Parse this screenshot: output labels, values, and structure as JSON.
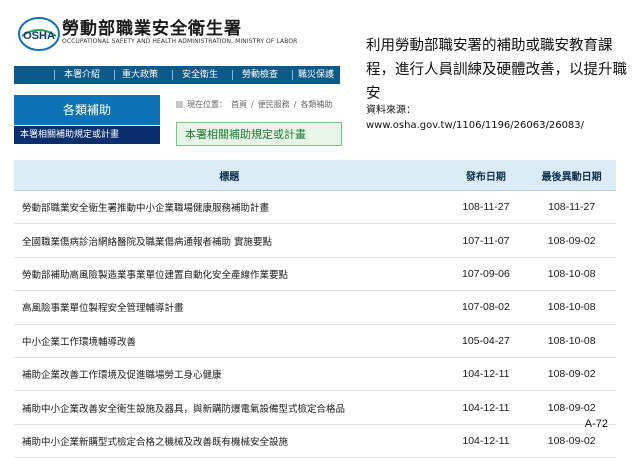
{
  "header": {
    "logo_text": "OSHA",
    "title": "勞動部職業安全衛生署",
    "subtitle": "OCCUPATIONAL SAFETY AND HEALTH ADMINISTRATION, MINISTRY OF LABOR"
  },
  "nav": {
    "items": [
      "本署介紹",
      "重大政策",
      "安全衛生",
      "勞動檢查",
      "職災保護"
    ]
  },
  "sidebar": {
    "heading": "各類補助",
    "items": [
      "本署相關補助規定或計畫"
    ]
  },
  "breadcrumb": {
    "label": "現在位置：",
    "items": [
      "首頁",
      "便民服務",
      "各類補助"
    ]
  },
  "page_title": "本署相關補助規定或計畫",
  "caption": {
    "text": "利用勞動部職安署的補助或職安教育課程，進行人員訓練及硬體改善，以提升職安",
    "source": "資料來源： www.osha.gov.tw/1106/1196/26063/26083/"
  },
  "table": {
    "headers": [
      "標題",
      "發布日期",
      "最後異動日期"
    ],
    "rows": [
      {
        "title": "勞動部職業安全衛生署推動中小企業職場健康服務補助計畫",
        "published": "108-11-27",
        "updated": "108-11-27"
      },
      {
        "title": "全國職業傷病診治網絡醫院及職業傷病通報者補助 實施要點",
        "published": "107-11-07",
        "updated": "108-09-02"
      },
      {
        "title": "勞動部補助高風險製造業事業單位建置自動化安全產線作業要點",
        "published": "107-09-06",
        "updated": "108-10-08"
      },
      {
        "title": "高風險事業單位製程安全管理輔導計畫",
        "published": "107-08-02",
        "updated": "108-10-08"
      },
      {
        "title": "中小企業工作環境輔導改善",
        "published": "105-04-27",
        "updated": "108-10-08"
      },
      {
        "title": "補助企業改善工作環境及促進職場勞工身心健康",
        "published": "104-12-11",
        "updated": "108-09-02"
      },
      {
        "title": "補助中小企業改善安全衛生設施及器具，與新購防爆電氣設備型式檢定合格品",
        "published": "104-12-11",
        "updated": "108-09-02"
      },
      {
        "title": "補助中小企業新購型式檢定合格之機械及改善既有機械安全設施",
        "published": "104-12-11",
        "updated": "108-09-02"
      }
    ]
  },
  "page_number": "A-72",
  "colors": {
    "nav_bg": "#0b5a8a",
    "sidebar_head": "#0c74b4",
    "sidebar_item": "#0b2f6e",
    "title_box_border": "#7cc28a",
    "table_header_bg": "#dcecf6"
  }
}
